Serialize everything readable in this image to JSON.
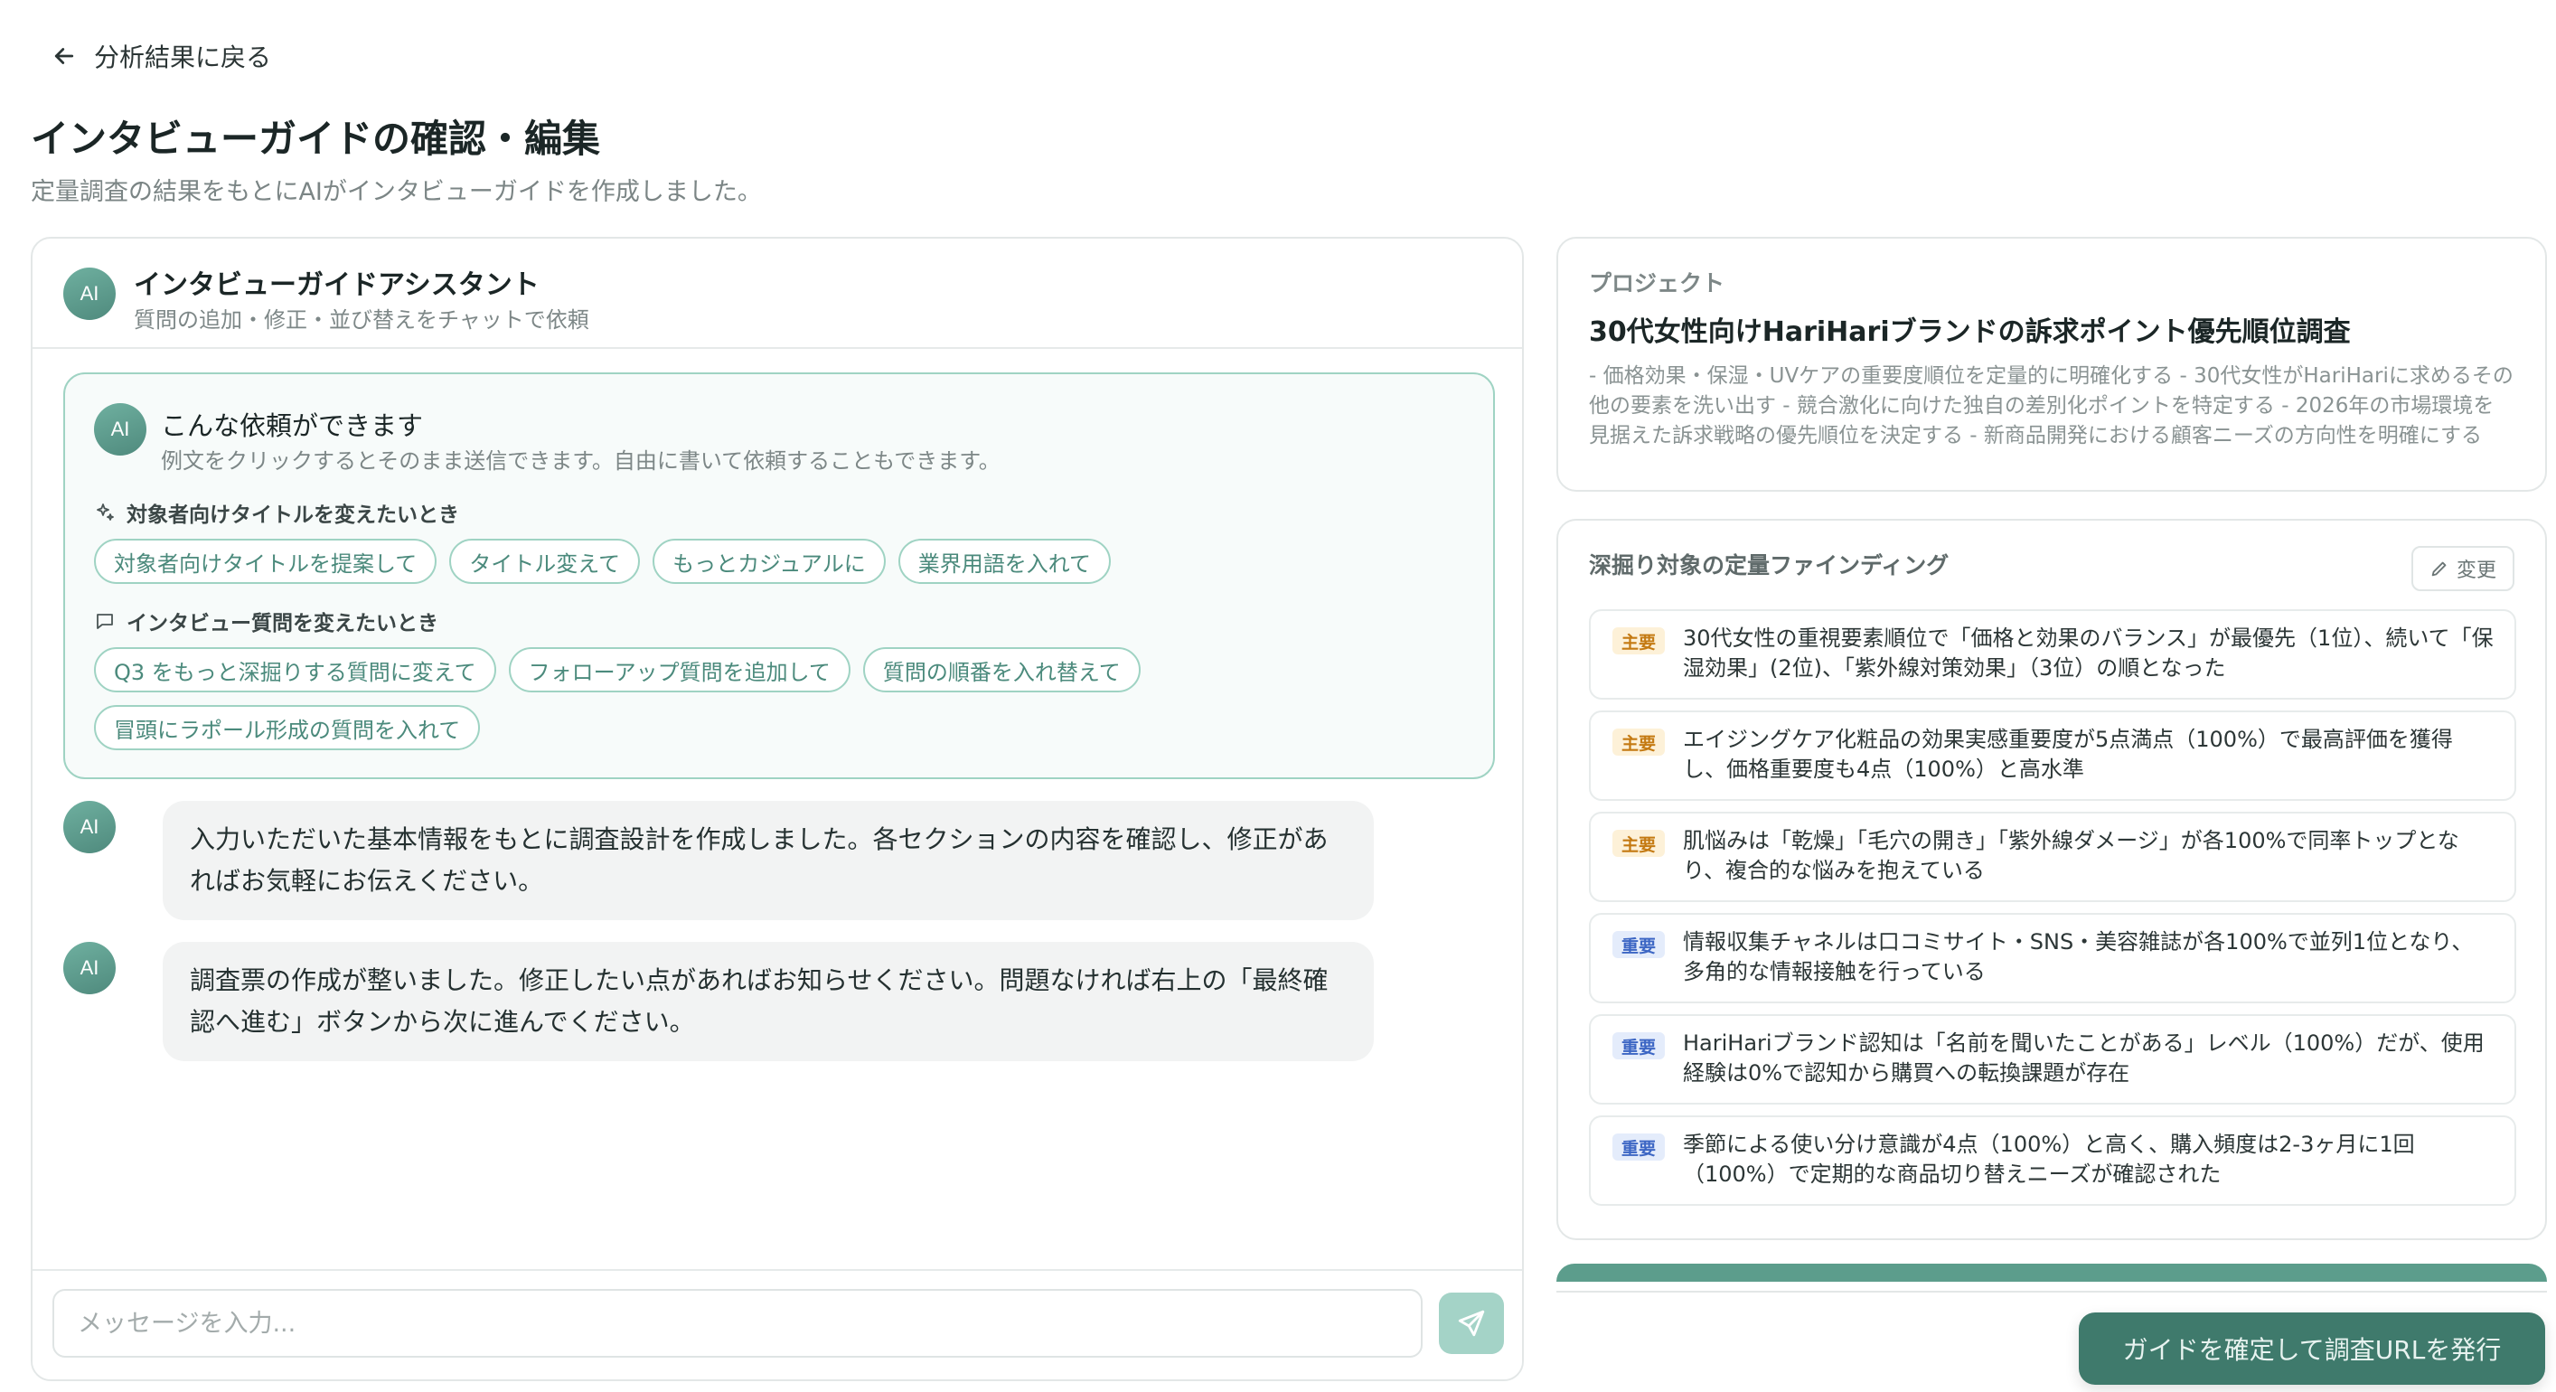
{
  "nav": {
    "back_label": "分析結果に戻る"
  },
  "page": {
    "title": "インタビューガイドの確認・編集",
    "subtitle": "定量調査の結果をもとにAIがインタビューガイドを作成しました。"
  },
  "chat": {
    "avatar_text": "AI",
    "header_title": "インタビューガイドアシスタント",
    "header_subtitle": "質問の追加・修正・並び替えをチャットで依頼",
    "suggestions": {
      "lead": "こんな依頼ができます",
      "lead_sub": "例文をクリックするとそのまま送信できます。自由に書いて依頼することもできます。",
      "groups": [
        {
          "label": "対象者向けタイトルを変えたいとき",
          "icon": "sparkles-icon",
          "chips": [
            "対象者向けタイトルを提案して",
            "タイトル変えて",
            "もっとカジュアルに",
            "業界用語を入れて"
          ]
        },
        {
          "label": "インタビュー質問を変えたいとき",
          "icon": "message-square-icon",
          "chips": [
            "Q3 をもっと深掘りする質問に変えて",
            "フォローアップ質問を追加して",
            "質問の順番を入れ替えて",
            "冒頭にラポール形成の質問を入れて"
          ]
        }
      ]
    },
    "messages": [
      {
        "text": "入力いただいた基本情報をもとに調査設計を作成しました。各セクションの内容を確認し、修正があればお気軽にお伝えください。"
      },
      {
        "text": "調査票の作成が整いました。修正したい点があればお知らせください。問題なければ右上の「最終確認へ進む」ボタンから次に進んでください。"
      }
    ],
    "input_placeholder": "メッセージを入力...",
    "input_value": ""
  },
  "project": {
    "label": "プロジェクト",
    "name": "30代女性向けHariHariブランドの訴求ポイント優先順位調査",
    "description": "- 価格効果・保湿・UVケアの重要度順位を定量的に明確化する - 30代女性がHariHariに求めるその他の要素を洗い出す - 競合激化に向けた独自の差別化ポイントを特定する - 2026年の市場環境を見据えた訴求戦略の優先順位を決定する - 新商品開発における顧客ニーズの方向性を明確にする"
  },
  "findings": {
    "label": "深掘り対象の定量ファインディング",
    "change_label": "変更",
    "items": [
      {
        "tag": "主要",
        "level": "main",
        "text": "30代女性の重視要素順位で「価格と効果のバランス」が最優先（1位）、続いて「保湿効果」(2位)、「紫外線対策効果」（3位）の順となった"
      },
      {
        "tag": "主要",
        "level": "main",
        "text": "エイジングケア化粧品の効果実感重要度が5点満点（100%）で最高評価を獲得し、価格重要度も4点（100%）と高水準"
      },
      {
        "tag": "主要",
        "level": "main",
        "text": "肌悩みは「乾燥」「毛穴の開き」「紫外線ダメージ」が各100%で同率トップとなり、複合的な悩みを抱えている"
      },
      {
        "tag": "重要",
        "level": "important",
        "text": "情報収集チャネルは口コミサイト・SNS・美容雑誌が各100%で並列1位となり、多角的な情報接触を行っている"
      },
      {
        "tag": "重要",
        "level": "important",
        "text": "HariHariブランド認知は「名前を聞いたことがある」レベル（100%）だが、使用経験は0%で認知から購買への転換課題が存在"
      },
      {
        "tag": "重要",
        "level": "important",
        "text": "季節による使い分け意識が4点（100%）と高く、購入頻度は2-3ヶ月に1回（100%）で定期的な商品切り替えニーズが確認された"
      }
    ]
  },
  "footer": {
    "primary_label": "ガイドを確定して調査URLを発行"
  },
  "colors": {
    "accent": "#3f7a6c",
    "chip_border": "#9fd3c3",
    "tag_main": "#c47a12",
    "tag_important": "#3c66c4"
  }
}
